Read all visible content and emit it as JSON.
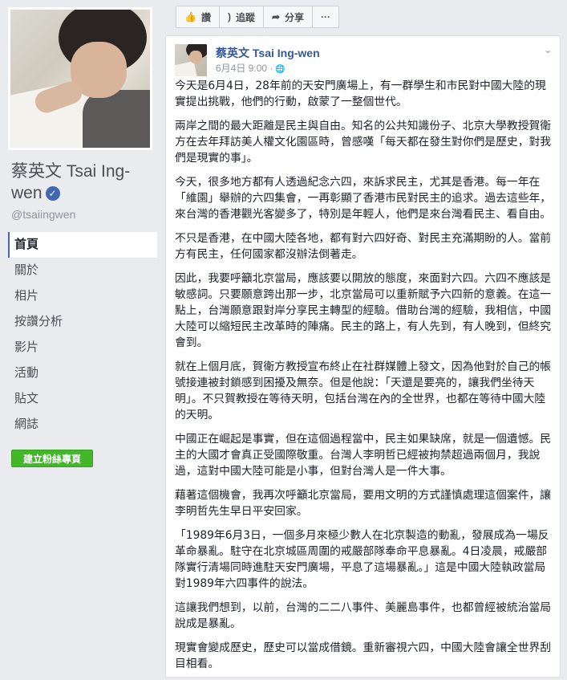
{
  "page": {
    "name": "蔡英文 Tsai Ing-wen",
    "name_line1": "蔡英文 Tsai Ing-",
    "name_line2": "wen",
    "handle": "@tsaiingwen"
  },
  "nav": {
    "items": [
      "首頁",
      "關於",
      "相片",
      "按讚分析",
      "影片",
      "活動",
      "貼文",
      "網誌"
    ],
    "active_index": 0,
    "create_button": "建立粉絲專頁"
  },
  "actions": {
    "like": "讚",
    "follow": "追蹤",
    "share": "分享",
    "more": "···"
  },
  "post": {
    "author": "蔡英文 Tsai Ing-wen",
    "timestamp": "6月4日 9:00 ·",
    "paragraphs": [
      "今天是6月4日，28年前的天安門廣場上，有一群學生和市民對中國大陸的現實提出挑戰，他們的行動，啟蒙了一整個世代。",
      "兩岸之間的最大距離是民主與自由。知名的公共知識份子、北京大學教授賀衛方在去年拜訪美人權文化園區時，曾感嘆「每天都在發生對你們是歷史，對我們是現實的事」。",
      "今天，很多地方都有人透過紀念六四，來訴求民主，尤其是香港。每一年在「維園」舉辦的六四集會，一再彰顯了香港市民對民主的追求。過去這些年，來台灣的香港觀光客變多了，特別是年輕人，他們是來台灣看民主、看自由。",
      "不只是香港，在中國大陸各地，都有對六四好奇、對民主充滿期盼的人。當前方有民主，任何國家都沒辦法倒著走。",
      "因此，我要呼籲北京當局，應該要以開放的態度，來面對六四。六四不應該是敏感詞。只要願意跨出那一步，北京當局可以重新賦予六四新的意義。在這一點上，台灣願意跟對岸分享民主轉型的經驗。借助台灣的經驗，我相信，中國大陸可以縮短民主改革時的陣痛。民主的路上，有人先到，有人晚到，但終究會到。",
      "就在上個月底，賀衛方教授宣布終止在社群媒體上發文，因為他對於自己的帳號接連被封鎖感到困擾及無奈。但是他說：「天還是要亮的，讓我們坐待天明」。不只賀教授在等待天明，包括台灣在內的全世界，也都在等待中國大陸的天明。",
      "中國正在崛起是事實，但在這個過程當中，民主如果缺席，就是一個遺憾。民主的大國才會真正受國際敬重。台灣人李明哲已經被拘禁超過兩個月，我說過，這對中國大陸可能是小事，但對台灣人是一件大事。",
      "藉著這個機會，我再次呼籲北京當局，要用文明的方式謹慎處理這個案件，讓李明哲先生早日平安回家。",
      "「1989年6月3日，一個多月來極少數人在北京製造的動亂，發展成為一場反革命暴亂。駐守在北京城區周圍的戒嚴部隊奉命平息暴亂。4日凌晨，戒嚴部隊實行清場同時進駐天安門廣場，平息了這場暴亂。」這是中國大陸執政當局對1989年六四事件的說法。",
      "這讓我們想到，以前，台灣的二二八事件、美麗島事件，也都曾經被統治當局說成是暴亂。",
      "現實會變成歷史，歷史可以當成借鏡。重新審視六四，中國大陸會讓全世界刮目相看。"
    ]
  }
}
